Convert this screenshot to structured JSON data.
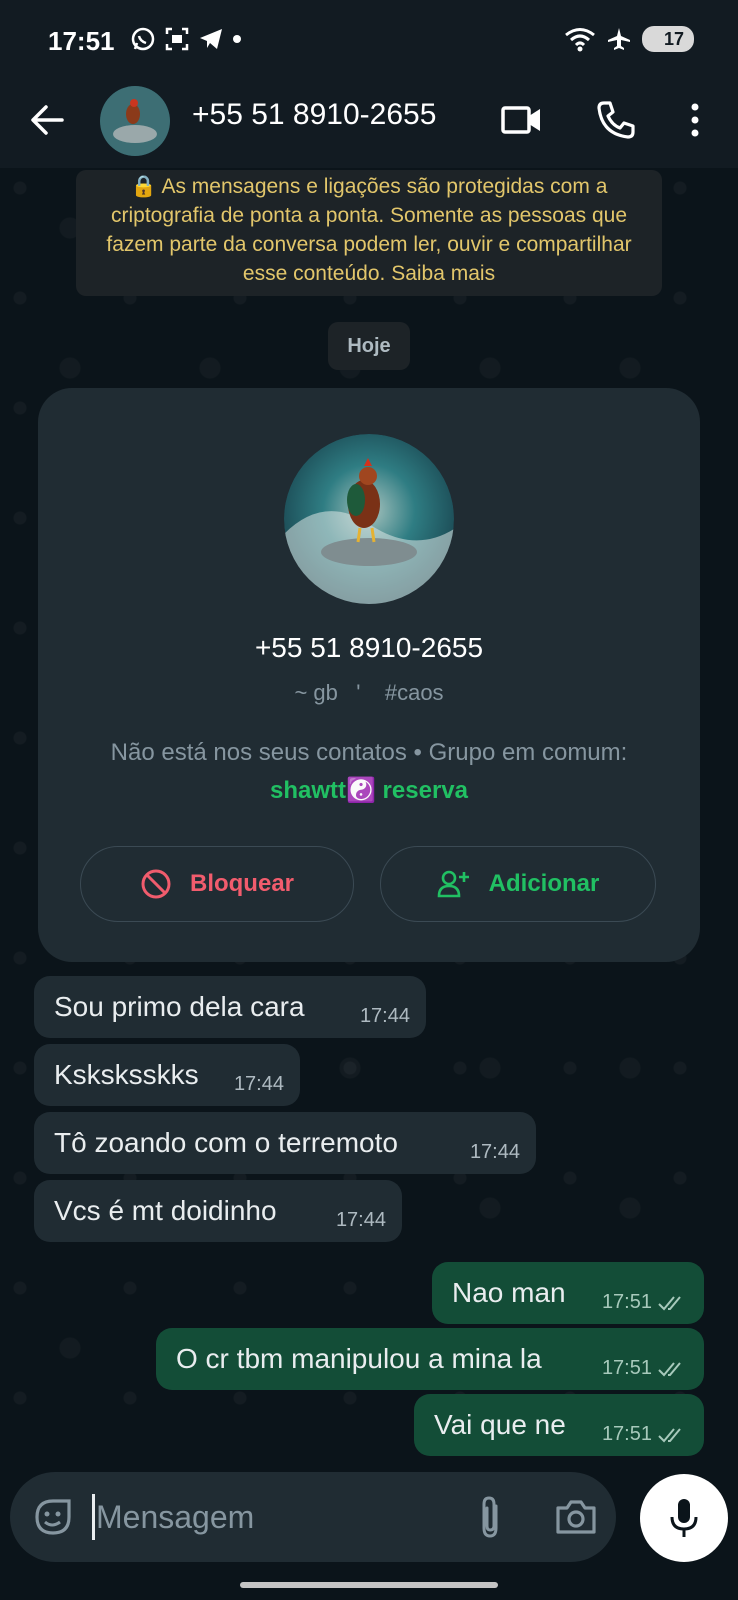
{
  "status_bar": {
    "time": "17:51",
    "battery": "17",
    "icons_left": [
      "whatsapp-icon",
      "screenshot-icon",
      "telegram-icon",
      "dot-icon"
    ],
    "icons_right": [
      "wifi-icon",
      "airplane-icon",
      "battery-icon"
    ]
  },
  "header": {
    "title": "+55 51 8910-2655",
    "icons": [
      "back-arrow-icon",
      "video-call-icon",
      "phone-icon",
      "more-vert-icon"
    ]
  },
  "encryption_notice": "🔒 As mensagens e ligações são protegidas com a criptografia de ponta a ponta. Somente as pessoas que fazem parte da conversa podem ler, ouvir e compartilhar esse conteúdo. Saiba mais",
  "date_chip": "Hoje",
  "profile_card": {
    "name": "+55 51 8910-2655",
    "subtitle": "~ gb   '    #caos",
    "info_text": "Não está nos seus contatos • Grupo em comum: ",
    "group_name": "shawtt☯️ reserva",
    "block_label": "Bloquear",
    "add_label": "Adicionar"
  },
  "messages": [
    {
      "direction": "in",
      "text": "Sou primo dela cara",
      "time": "17:44"
    },
    {
      "direction": "in",
      "text": "Ksksksskks",
      "time": "17:44"
    },
    {
      "direction": "in",
      "text": "Tô zoando com o terremoto",
      "time": "17:44"
    },
    {
      "direction": "in",
      "text": "Vcs é mt doidinho",
      "time": "17:44"
    },
    {
      "direction": "out",
      "text": "Nao man",
      "time": "17:51",
      "read": true
    },
    {
      "direction": "out",
      "text": "O cr tbm manipulou a mina la",
      "time": "17:51",
      "read": true
    },
    {
      "direction": "out",
      "text": "Vai que ne",
      "time": "17:51",
      "read": true
    }
  ],
  "input": {
    "placeholder": "Mensagem",
    "value": ""
  },
  "colors": {
    "background": "#0b141a",
    "header": "#121b22",
    "incoming_bubble": "#202c33",
    "outgoing_bubble": "#134d37",
    "accent_green": "#21c063",
    "danger_red": "#f15c6d",
    "notice_text": "#e2c66b"
  }
}
